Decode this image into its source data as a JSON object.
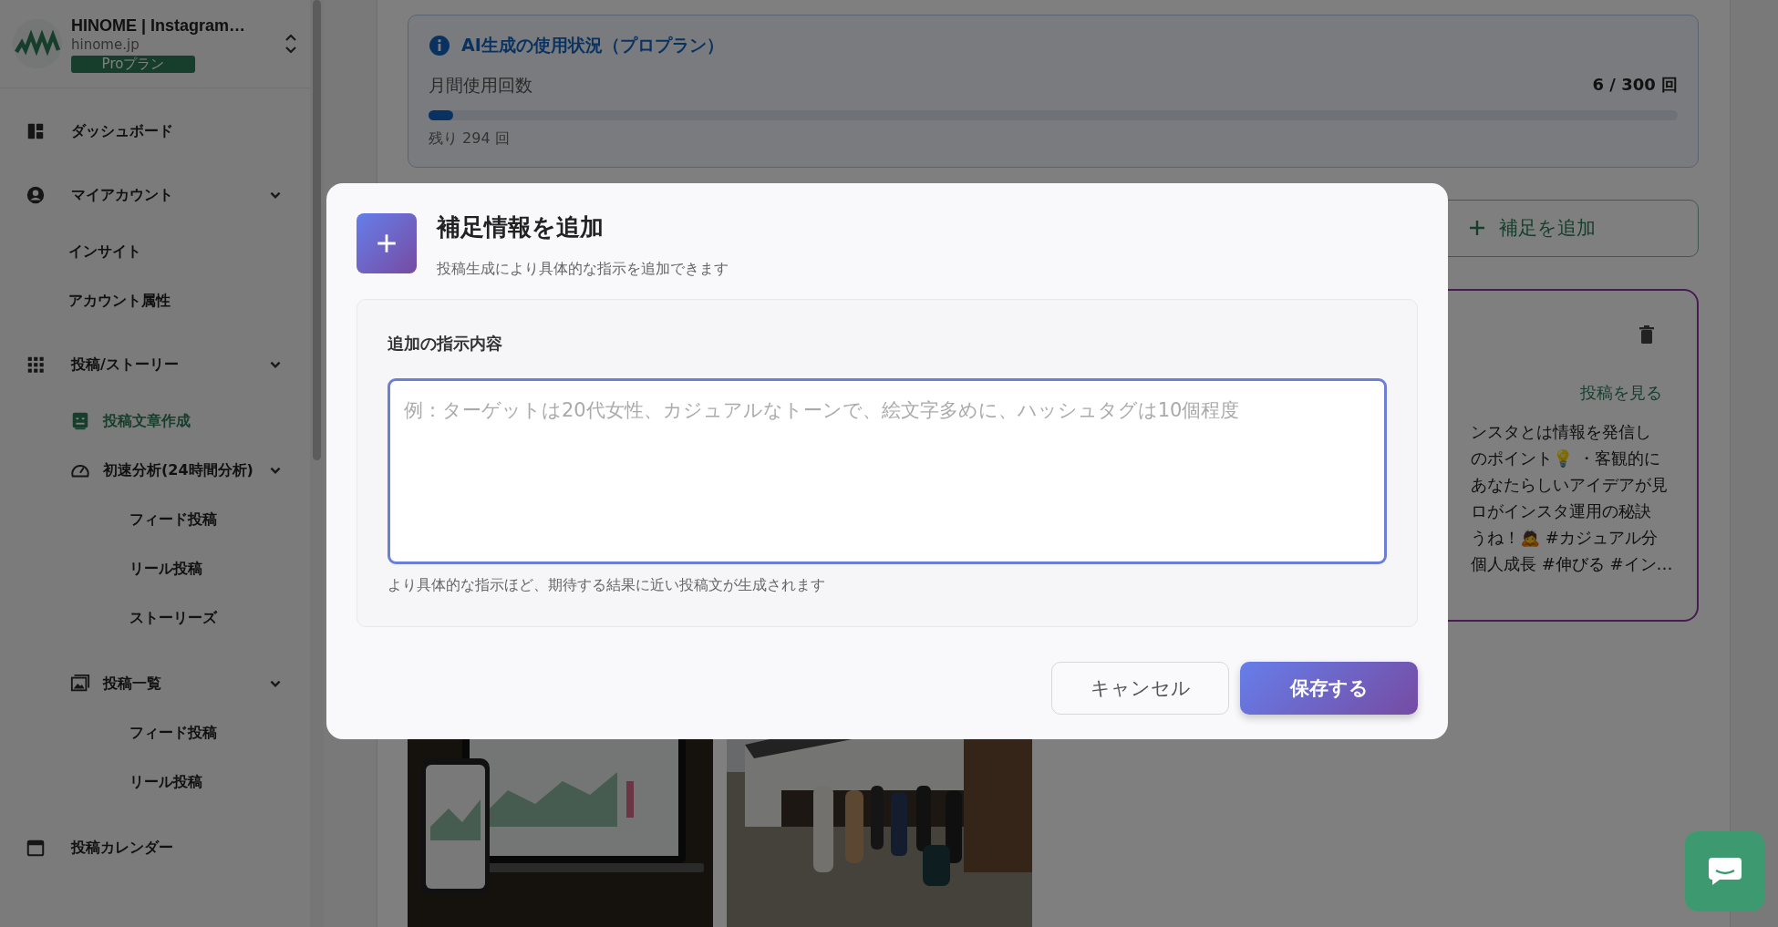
{
  "sidebar": {
    "account": {
      "name": "HINOME | Instagram…",
      "domain": "hinome.jp",
      "plan": "Proプラン"
    },
    "items": [
      {
        "label": "ダッシュボード",
        "selected": false
      },
      {
        "label": "マイアカウント",
        "selected": false,
        "expanded": true,
        "children": [
          {
            "label": "インサイト",
            "selected": false
          },
          {
            "label": "アカウント属性",
            "selected": false
          }
        ]
      },
      {
        "label": "投稿/ストーリー",
        "selected": false,
        "expanded": true,
        "children": [
          {
            "label": "投稿文章作成",
            "selected": true
          },
          {
            "label": "初速分析(24時間分析)",
            "selected": false,
            "expanded": true,
            "children": [
              {
                "label": "フィード投稿",
                "selected": false
              },
              {
                "label": "リール投稿",
                "selected": false
              },
              {
                "label": "ストーリーズ",
                "selected": false
              }
            ]
          },
          {
            "label": "投稿一覧",
            "selected": false,
            "expanded": true,
            "children": [
              {
                "label": "フィード投稿",
                "selected": false
              },
              {
                "label": "リール投稿",
                "selected": false
              }
            ]
          }
        ]
      },
      {
        "label": "投稿カレンダー",
        "selected": false
      }
    ]
  },
  "usage": {
    "title": "AI生成の使用状況（プロプラン）",
    "label": "月間使用回数",
    "count": "6 / 300 回",
    "level": 0.02,
    "remaining": "残り 294 回"
  },
  "add_button": {
    "label": "補足を追加"
  },
  "post_card": {
    "link": "投稿を見る",
    "lines": [
      "ンスタとは情報を発信し",
      "のポイント💡 ・客観的に",
      "あなたらしいアイデアが見",
      "ロがインスタ運用の秘訣",
      "うね！🙇 #カジュアル分",
      "個人成長 #伸びる #イン…"
    ]
  },
  "dialog": {
    "title": "補足情報を追加",
    "subtitle": "投稿生成により具体的な指示を追加できます",
    "field_label": "追加の指示内容",
    "placeholder": "例：ターゲットは20代女性、カジュアルなトーンで、絵文字多めに、ハッシュタグは10個程度",
    "hint": "より具体的な指示ほど、期待する結果に近い投稿文が生成されます",
    "buttons": [
      {
        "label": "キャンセル",
        "kind": "secondary"
      },
      {
        "label": "保存する",
        "kind": "primary"
      }
    ]
  }
}
